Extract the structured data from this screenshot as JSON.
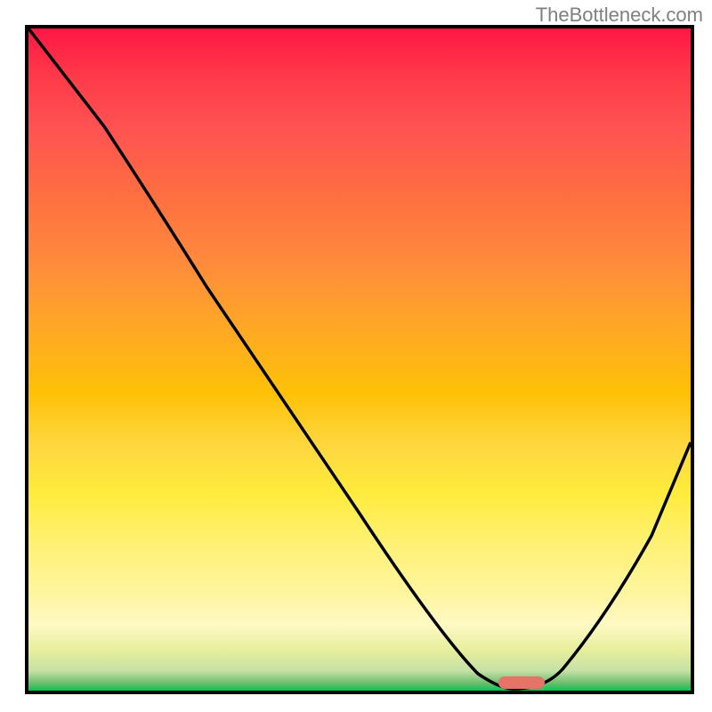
{
  "attribution": "TheBottleneck.com",
  "chart_data": {
    "type": "line",
    "title": "",
    "xlabel": "",
    "ylabel": "",
    "xlim": [
      0,
      100
    ],
    "ylim": [
      0,
      100
    ],
    "curve": {
      "name": "bottleneck-curve",
      "points": [
        {
          "x": 0,
          "y": 100
        },
        {
          "x": 20,
          "y": 72
        },
        {
          "x": 35,
          "y": 50
        },
        {
          "x": 50,
          "y": 27
        },
        {
          "x": 62,
          "y": 8
        },
        {
          "x": 68,
          "y": 1
        },
        {
          "x": 73,
          "y": 0
        },
        {
          "x": 78,
          "y": 1
        },
        {
          "x": 85,
          "y": 10
        },
        {
          "x": 92,
          "y": 22
        },
        {
          "x": 100,
          "y": 38
        }
      ]
    },
    "optimal_marker": {
      "x_start": 71,
      "x_end": 78,
      "y": 0.5,
      "color": "#e57368"
    },
    "gradient_stops": [
      {
        "pos": 0,
        "color": "#ff1744"
      },
      {
        "pos": 50,
        "color": "#ffc107"
      },
      {
        "pos": 100,
        "color": "#00c853"
      }
    ]
  }
}
